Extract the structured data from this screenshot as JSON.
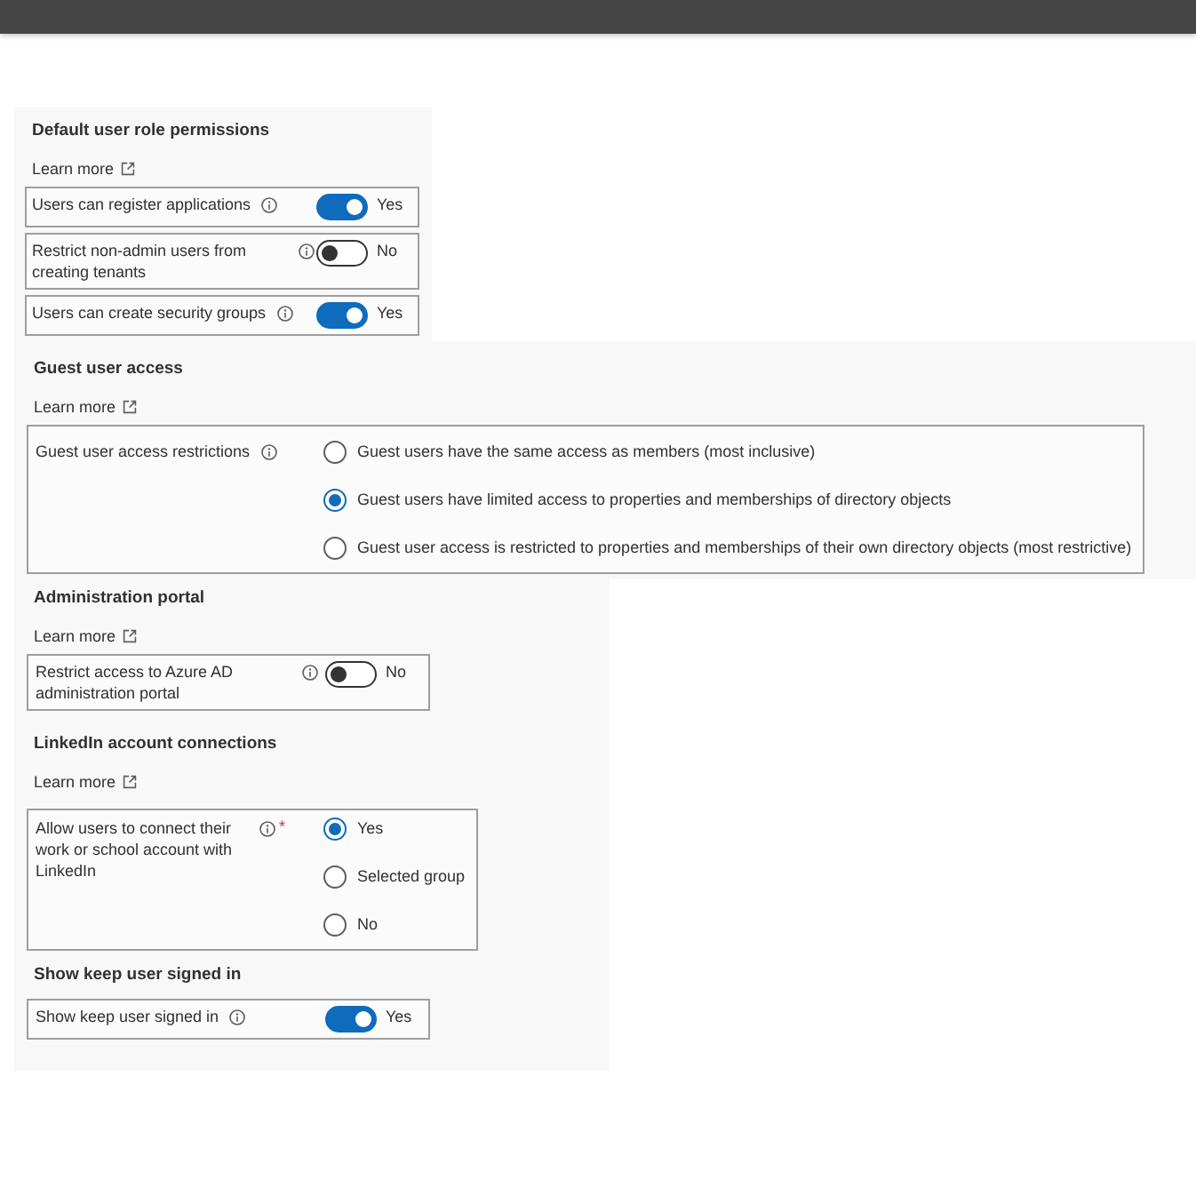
{
  "sections": [
    {
      "heading": "Default user role permissions",
      "learn_more": "Learn more",
      "settings": [
        {
          "kind": "toggle",
          "label": "Users can register applications",
          "on": true,
          "value": "Yes"
        },
        {
          "kind": "toggle",
          "label": "Restrict non-admin users from creating tenants",
          "on": false,
          "value": "No"
        },
        {
          "kind": "toggle",
          "label": "Users can create security groups",
          "on": true,
          "value": "Yes"
        }
      ]
    },
    {
      "heading": "Guest user access",
      "learn_more": "Learn more",
      "settings": [
        {
          "kind": "radio",
          "label": "Guest user access restrictions",
          "options": [
            {
              "label": "Guest users have the same access as members (most inclusive)",
              "selected": false
            },
            {
              "label": "Guest users have limited access to properties and memberships of directory objects",
              "selected": true
            },
            {
              "label": "Guest user access is restricted to properties and memberships of their own directory objects (most restrictive)",
              "selected": false
            }
          ]
        }
      ]
    },
    {
      "heading": "Administration portal",
      "learn_more": "Learn more",
      "settings": [
        {
          "kind": "toggle",
          "label": "Restrict access to Azure AD administration portal",
          "on": false,
          "value": "No"
        }
      ]
    },
    {
      "heading": "LinkedIn account connections",
      "learn_more": "Learn more",
      "settings": [
        {
          "kind": "radio",
          "label": "Allow users to connect their work or school account with LinkedIn",
          "required": "*",
          "options": [
            {
              "label": "Yes",
              "selected": true
            },
            {
              "label": "Selected group",
              "selected": false
            },
            {
              "label": "No",
              "selected": false
            }
          ]
        }
      ]
    },
    {
      "heading": "Show keep user signed in",
      "settings": [
        {
          "kind": "toggle",
          "label": "Show keep user signed in",
          "on": true,
          "value": "Yes"
        }
      ]
    }
  ]
}
